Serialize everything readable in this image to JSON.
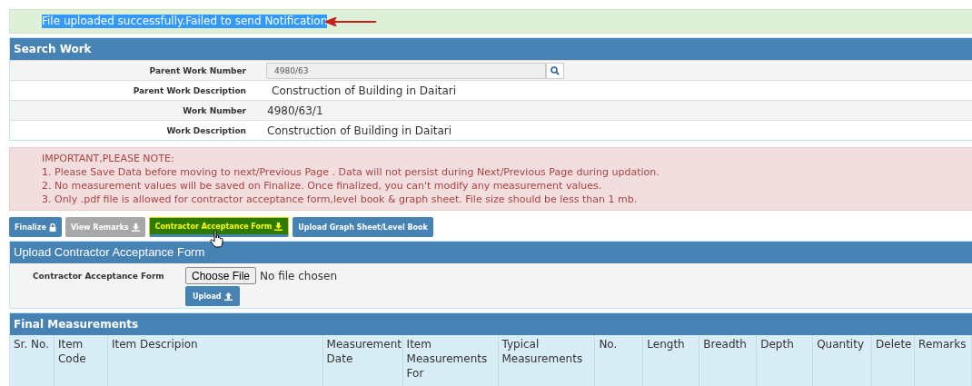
{
  "message": {
    "text": "File uploaded successfully.Failed to send Notification"
  },
  "search_work": {
    "title": "Search Work",
    "fields": [
      {
        "label": "Parent Work Number",
        "value": "4980/63",
        "kind": "input"
      },
      {
        "label": "Parent Work Description",
        "value": "Construction of Building in Daitari",
        "kind": "text"
      },
      {
        "label": "Work Number",
        "value": "4980/63/1",
        "kind": "text"
      },
      {
        "label": "Work Description",
        "value": "Construction of Building in Daitari",
        "kind": "text"
      }
    ]
  },
  "notice": {
    "title": "IMPORTANT,PLEASE NOTE:",
    "lines": [
      "1. Please Save Data before moving to next/Previous Page . Data will not persist during Next/Previous Page during updation.",
      "2. No measurement values will be saved on Finalize. Once finalized, you can't modify any measurement values.",
      "3. Only .pdf file is allowed for contractor acceptance form,level book & graph sheet. File size should be less than 1 mb."
    ]
  },
  "buttons": [
    {
      "label": "Finalize",
      "kind": "normal"
    },
    {
      "label": "View Remarks",
      "kind": "disabled"
    },
    {
      "label": "Contractor Acceptance Form",
      "kind": "highlighted"
    },
    {
      "label": "Upload Graph Sheet/Level Book",
      "kind": "normal"
    }
  ],
  "upload": {
    "title": "Upload Contractor Acceptance Form",
    "label": "Contractor Acceptance Form",
    "choose_button": "Choose File",
    "file_status": "No file chosen",
    "upload_button": "Upload"
  },
  "final_measurements": {
    "title": "Final Measurements",
    "columns": [
      "Sr. No.",
      "Item Code",
      "Item Descripion",
      "Measurement Date",
      "Item Measurements For",
      "Typical Measurements",
      "No.",
      "Length",
      "Breadth",
      "Depth",
      "Quantity",
      "Delete",
      "Remarks"
    ]
  }
}
